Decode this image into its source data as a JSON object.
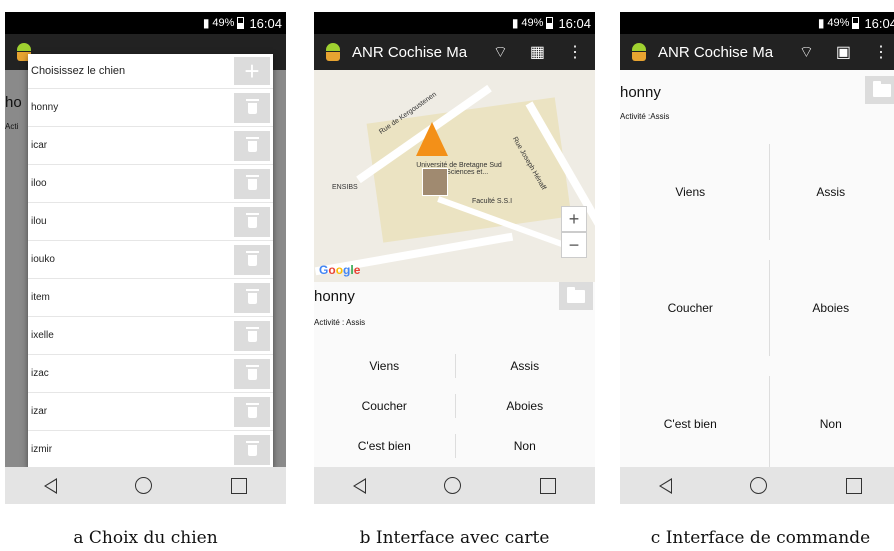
{
  "status": {
    "battery": "49%",
    "time": "16:04"
  },
  "app": {
    "title": "ANR Cochise Ma"
  },
  "panel_a": {
    "behind_name": "ho",
    "behind_activity": "Acti",
    "dialog_title": "Choisissez le chien",
    "dogs": [
      "honny",
      "icar",
      "iloo",
      "ilou",
      "iouko",
      "item",
      "ixelle",
      "izac",
      "izar",
      "izmir"
    ],
    "caption": "a Choix du chien"
  },
  "panel_b": {
    "map": {
      "street1": "Rue de Kergoustenen",
      "street2": "Rue Joseph Hénaff",
      "poi_univ": "Université de Bretagne Sud UBS Sciences et...",
      "poi_ensibs": "ENSIBS",
      "poi_faculte": "Faculté S.S.I",
      "google": [
        "G",
        "o",
        "o",
        "g",
        "l",
        "e"
      ]
    },
    "dog_name": "honny",
    "activity": "Activité : Assis",
    "commands": [
      [
        "Viens",
        "Assis"
      ],
      [
        "Coucher",
        "Aboies"
      ],
      [
        "C'est bien",
        "Non"
      ]
    ],
    "caption": "b Interface avec carte"
  },
  "panel_c": {
    "dog_name": "honny",
    "activity": "Activité :Assis",
    "commands": [
      [
        "Viens",
        "Assis"
      ],
      [
        "Coucher",
        "Aboies"
      ],
      [
        "C'est bien",
        "Non"
      ]
    ],
    "caption": "c Interface de commande"
  },
  "icons": {
    "wifi": "wifi-icon",
    "grid": "grid-icon",
    "map": "map-icon",
    "overflow": "overflow-menu-icon",
    "folder": "folder-icon",
    "trash": "trash-icon",
    "add": "add-icon"
  }
}
